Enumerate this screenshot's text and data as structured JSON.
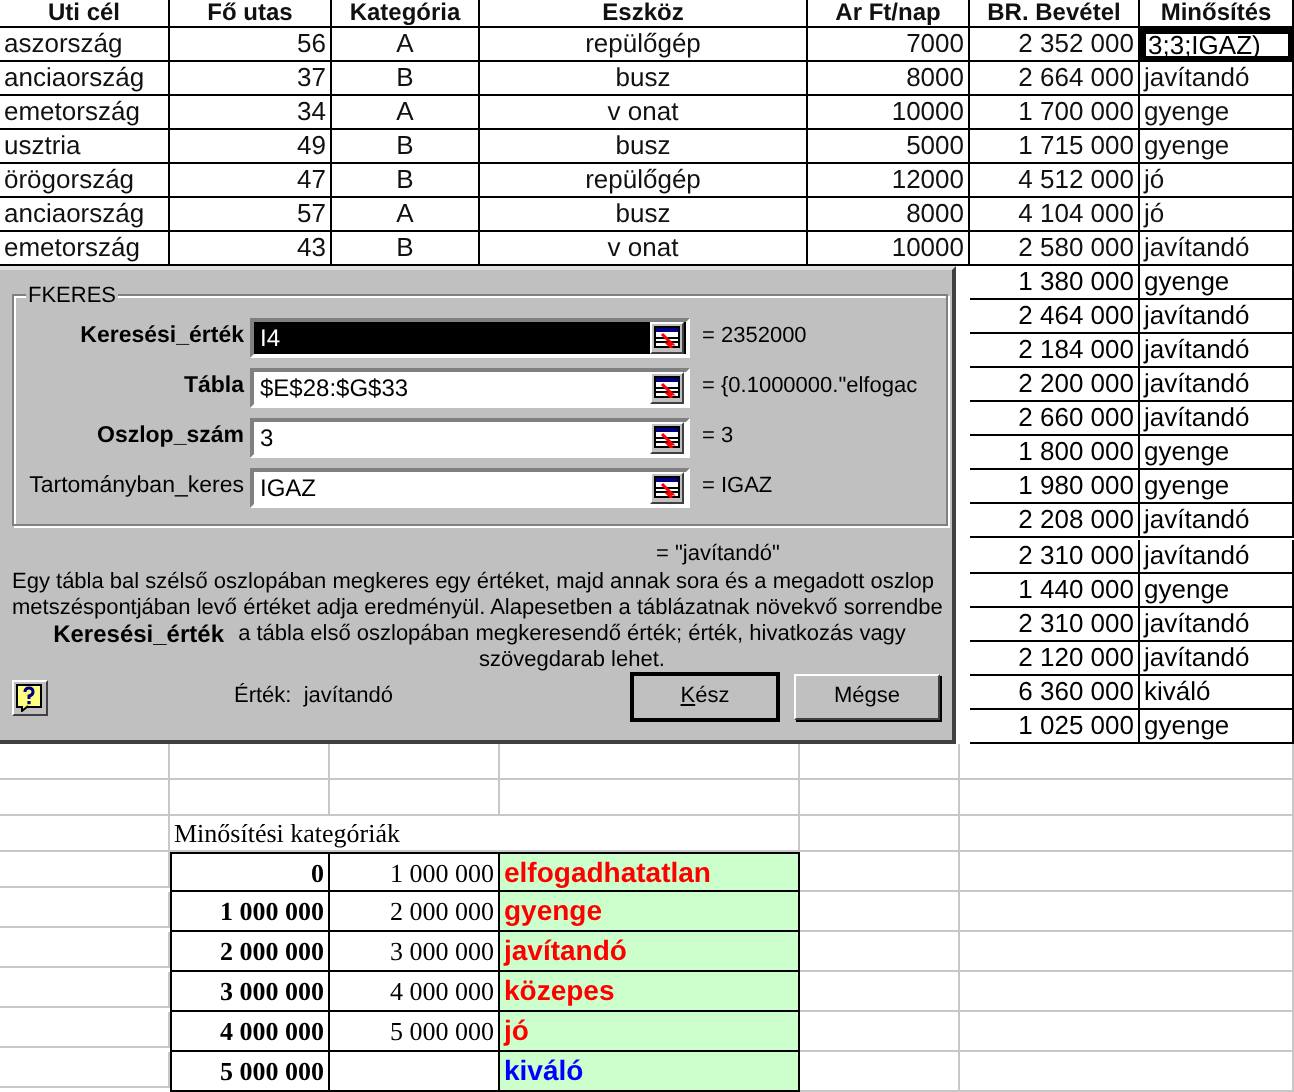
{
  "sheet": {
    "columns": [
      "Uti cél",
      "Fő utas",
      "Kategória",
      "Eszköz",
      "Ar Ft/nap",
      "BR. Bevétel",
      "Minősítés"
    ],
    "rows": [
      {
        "cells": [
          "aszország",
          "56",
          "A",
          "repülőgép",
          "7000",
          "2 352 000",
          "3;3;IGAZ)"
        ],
        "selected": true
      },
      {
        "cells": [
          "anciaország",
          "37",
          "B",
          "busz",
          "8000",
          "2 664 000",
          "javítandó"
        ],
        "selected": false
      },
      {
        "cells": [
          "emetország",
          "34",
          "A",
          "v onat",
          "10000",
          "1 700 000",
          "gyenge"
        ],
        "selected": false
      },
      {
        "cells": [
          "usztria",
          "49",
          "B",
          "busz",
          "5000",
          "1 715 000",
          "gyenge"
        ],
        "selected": false
      },
      {
        "cells": [
          "örögország",
          "47",
          "B",
          "repülőgép",
          "12000",
          "4 512 000",
          "jó"
        ],
        "selected": false
      },
      {
        "cells": [
          "anciaország",
          "57",
          "A",
          "busz",
          "8000",
          "4 104 000",
          "jó"
        ],
        "selected": false
      },
      {
        "cells": [
          "emetország",
          "43",
          "B",
          "v onat",
          "10000",
          "2 580 000",
          "javítandó"
        ],
        "selected": false
      }
    ],
    "side_rows": [
      {
        "revenue": "1 380 000",
        "rating": "gyenge"
      },
      {
        "revenue": "2 464 000",
        "rating": "javítandó"
      },
      {
        "revenue": "2 184 000",
        "rating": "javítandó"
      },
      {
        "revenue": "2 200 000",
        "rating": "javítandó"
      },
      {
        "revenue": "2 660 000",
        "rating": "javítandó"
      },
      {
        "revenue": "1 800 000",
        "rating": "gyenge"
      },
      {
        "revenue": "1 980 000",
        "rating": "gyenge"
      },
      {
        "revenue": "2 208 000",
        "rating": "javítandó"
      },
      {
        "revenue": "2 310 000",
        "rating": "javítandó"
      },
      {
        "revenue": "1 440 000",
        "rating": "gyenge"
      },
      {
        "revenue": "2 310 000",
        "rating": "javítandó"
      },
      {
        "revenue": "2 120 000",
        "rating": "javítandó"
      },
      {
        "revenue": "6 360 000",
        "rating": "kiváló"
      },
      {
        "revenue": "1 025 000",
        "rating": "gyenge"
      }
    ]
  },
  "dialog": {
    "group_label": "FKERES",
    "arguments": [
      {
        "label": "Keresési_érték",
        "required": true,
        "value": "I4",
        "result": "= 2352000",
        "focused": true
      },
      {
        "label": "Tábla",
        "required": true,
        "value": "$E$28:$G$33",
        "result": "= {0.1000000.\"elfogac",
        "focused": false
      },
      {
        "label": "Oszlop_szám",
        "required": true,
        "value": "3",
        "result": "= 3",
        "focused": false
      },
      {
        "label": "Tartományban_keres",
        "required": false,
        "value": "IGAZ",
        "result": "= IGAZ",
        "focused": false
      }
    ],
    "formula_result": "= \"javítandó\"",
    "description": "Egy tábla bal szélső oszlopában megkeres egy értéket, majd annak sora és a megadott oszlop metszéspontjában levő értéket adja eredményül. Alapesetben a táblázatnak növekvő sorrendbe",
    "argument_help_label": "Keresési_érték",
    "argument_help": "a tábla első oszlopában megkeresendő érték; érték, hivatkozás vagy szövegdarab lehet.",
    "value_label": "Érték:",
    "value": "javítandó",
    "buttons": [
      {
        "label": "Kész",
        "kind": "ok"
      },
      {
        "label": "Mégse",
        "kind": "cancel"
      }
    ]
  },
  "category_table": {
    "title": "Minősítési kategóriák",
    "rows": [
      {
        "from": "0",
        "to": "1 000 000",
        "label": "elfogadhatatlan",
        "color": "#ff0000"
      },
      {
        "from": "1 000 000",
        "to": "2 000 000",
        "label": "gyenge",
        "color": "#ff0000"
      },
      {
        "from": "2 000 000",
        "to": "3 000 000",
        "label": "javítandó",
        "color": "#ff0000"
      },
      {
        "from": "3 000 000",
        "to": "4 000 000",
        "label": "közepes",
        "color": "#ff0000"
      },
      {
        "from": "4 000 000",
        "to": "5 000 000",
        "label": "jó",
        "color": "#ff0000"
      },
      {
        "from": "5 000 000",
        "label": "kiváló",
        "color": "#0000ff"
      }
    ]
  }
}
